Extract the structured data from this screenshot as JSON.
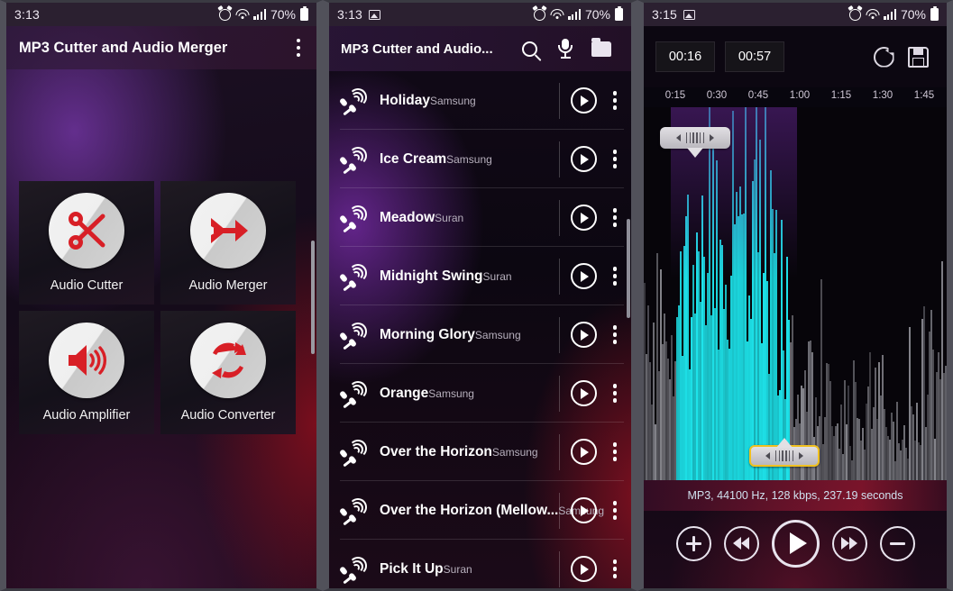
{
  "panel1": {
    "status": {
      "time": "3:13",
      "battery": "70%",
      "icons": [
        "alarm-icon",
        "wifi-icon",
        "signal-icon",
        "battery-icon"
      ]
    },
    "appbar": {
      "title": "MP3 Cutter and Audio Merger",
      "overflow": "overflow-menu"
    },
    "tiles": [
      {
        "label": "Audio Cutter",
        "icon": "scissors-icon"
      },
      {
        "label": "Audio Merger",
        "icon": "merge-arrow-icon"
      },
      {
        "label": "Audio Amplifier",
        "icon": "speaker-icon"
      },
      {
        "label": "Audio Converter",
        "icon": "convert-refresh-icon"
      }
    ]
  },
  "panel2": {
    "status": {
      "time": "3:13",
      "battery": "70%",
      "image_icon": "image-icon"
    },
    "appbar": {
      "title": "MP3 Cutter and Audio...",
      "search": "search-icon",
      "mic": "mic-icon",
      "folder": "folder-icon"
    },
    "tracks": [
      {
        "title": "Holiday",
        "artist": "Samsung"
      },
      {
        "title": "Ice Cream",
        "artist": "Samsung"
      },
      {
        "title": "Meadow",
        "artist": "Suran"
      },
      {
        "title": "Midnight Swing",
        "artist": "Suran"
      },
      {
        "title": "Morning Glory",
        "artist": "Samsung"
      },
      {
        "title": "Orange",
        "artist": "Samsung"
      },
      {
        "title": "Over the Horizon",
        "artist": "Samsung"
      },
      {
        "title": "Over the Horizon (Mellow...",
        "artist": "Samsung"
      },
      {
        "title": "Pick It Up",
        "artist": "Suran"
      }
    ]
  },
  "panel3": {
    "status": {
      "time": "3:15",
      "battery": "70%",
      "image_icon": "image-icon"
    },
    "editor": {
      "start_time": "00:16",
      "end_time": "00:57",
      "reset_icon": "reset-icon",
      "save_icon": "save-icon",
      "ruler_ticks": [
        "0:15",
        "0:30",
        "0:45",
        "1:00",
        "1:15",
        "1:30",
        "1:45"
      ],
      "info": "MP3, 44100 Hz, 128 kbps, 237.19 seconds",
      "selection_color": "#1ee8ef",
      "handle_selected_color": "#f0c020",
      "transport": [
        {
          "name": "zoom-in-button",
          "icon": "plus-icon"
        },
        {
          "name": "rewind-button",
          "icon": "rewind-icon"
        },
        {
          "name": "play-button",
          "icon": "play-icon"
        },
        {
          "name": "forward-button",
          "icon": "forward-icon"
        },
        {
          "name": "zoom-out-button",
          "icon": "minus-icon"
        }
      ]
    }
  }
}
